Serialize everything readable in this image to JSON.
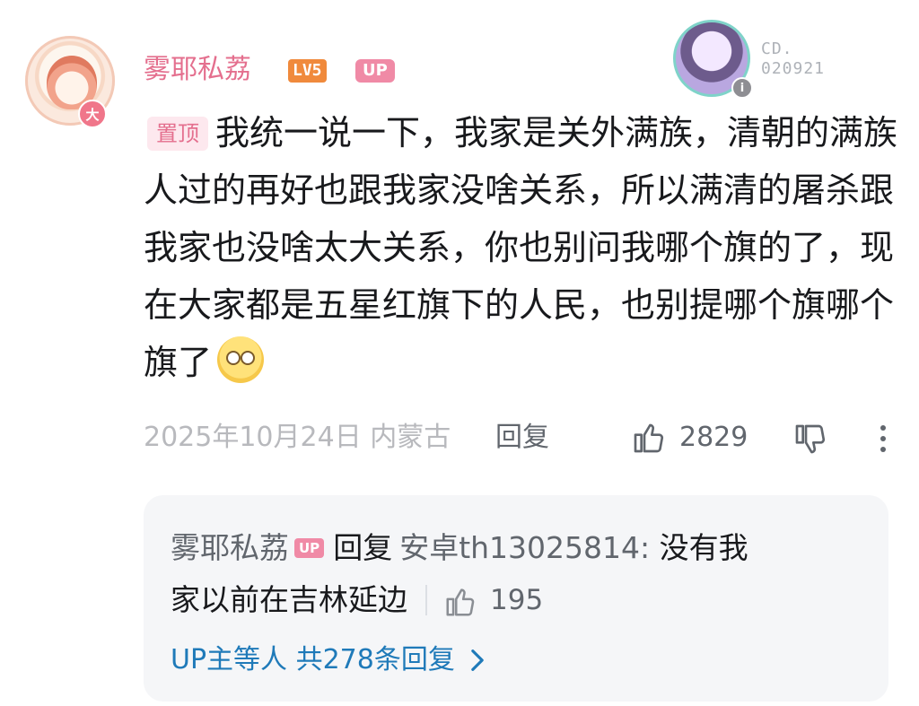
{
  "comment": {
    "username": "雾耶私荔",
    "level_label": "LV5",
    "up_label": "UP",
    "avatar_badge": "大",
    "sticker_text_line1": "CD.",
    "sticker_text_line2": "020921",
    "pin_label": "置顶",
    "body": "我统一说一下，我家是关外满族，清朝的满族人过的再好也跟我家没啥关系，所以满清的屠杀跟我家也没啥太大关系，你也别问我哪个旗的了，现在大家都是五星红旗下的人民，也别提哪个旗哪个旗了",
    "emoji": "eyes-rolled-emoji",
    "date": "2025年10月24日",
    "location": "内蒙古",
    "reply_label": "回复",
    "like_count": "2829"
  },
  "reply_preview": {
    "username": "雾耶私荔",
    "up_label": "UP",
    "verb": "回复",
    "target": "安卓th13025814:",
    "text_part1": "没有我",
    "text_part2": "家以前在吉林延边",
    "like_count": "195",
    "more_replies_label": "UP主等人 共278条回复"
  },
  "colors": {
    "username": "#e46f8e",
    "up_tag": "#f08aa6",
    "level_tag": "#f08a3c",
    "link_blue": "#1f7ab9",
    "reply_bg": "#f5f6f8"
  }
}
